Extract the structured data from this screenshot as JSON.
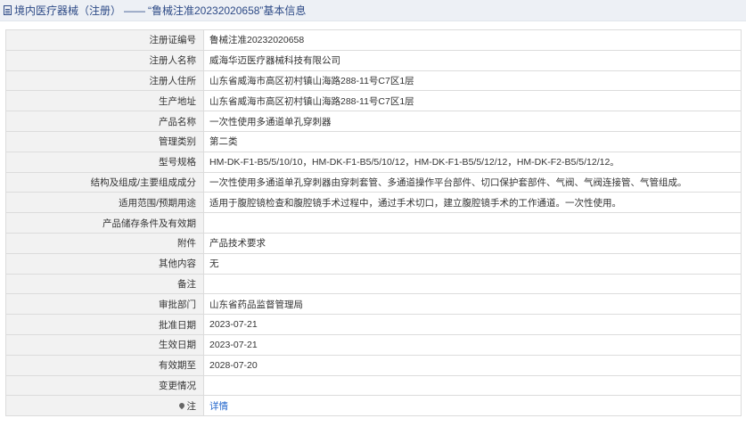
{
  "header": {
    "category": "境内医疗器械（注册）",
    "separator": "——",
    "record_title": "“鲁械注准20232020658”基本信息"
  },
  "fields": {
    "reg_no": {
      "label": "注册证编号",
      "value": "鲁械注准20232020658"
    },
    "registrant": {
      "label": "注册人名称",
      "value": "威海华迈医疗器械科技有限公司"
    },
    "registrant_address": {
      "label": "注册人住所",
      "value": "山东省威海市高区初村镇山海路288-11号C7区1层"
    },
    "production_address": {
      "label": "生产地址",
      "value": "山东省威海市高区初村镇山海路288-11号C7区1层"
    },
    "product_name": {
      "label": "产品名称",
      "value": "一次性使用多通道单孔穿刺器"
    },
    "mgmt_class": {
      "label": "管理类别",
      "value": "第二类"
    },
    "models": {
      "label": "型号规格",
      "value": "HM-DK-F1-B5/5/10/10，HM-DK-F1-B5/5/10/12，HM-DK-F1-B5/5/12/12，HM-DK-F2-B5/5/12/12。"
    },
    "structure": {
      "label": "结构及组成/主要组成成分",
      "value": "一次性使用多通道单孔穿刺器由穿刺套管、多通道操作平台部件、切口保护套部件、气阀、气阀连接管、气管组成。"
    },
    "scope": {
      "label": "适用范围/预期用途",
      "value": "适用于腹腔镜检查和腹腔镜手术过程中，通过手术切口，建立腹腔镜手术的工作通道。一次性使用。"
    },
    "storage": {
      "label": "产品储存条件及有效期",
      "value": ""
    },
    "attachment": {
      "label": "附件",
      "value": "产品技术要求"
    },
    "other": {
      "label": "其他内容",
      "value": "无"
    },
    "remarks": {
      "label": "备注",
      "value": ""
    },
    "approval_dept": {
      "label": "审批部门",
      "value": "山东省药品监督管理局"
    },
    "approval_date": {
      "label": "批准日期",
      "value": "2023-07-21"
    },
    "effective_date": {
      "label": "生效日期",
      "value": "2023-07-21"
    },
    "expiry_date": {
      "label": "有效期至",
      "value": "2028-07-20"
    },
    "change_info": {
      "label": "变更情况",
      "value": ""
    },
    "note": {
      "label": "注",
      "value": "详情",
      "icon": "location-pin-icon"
    }
  }
}
